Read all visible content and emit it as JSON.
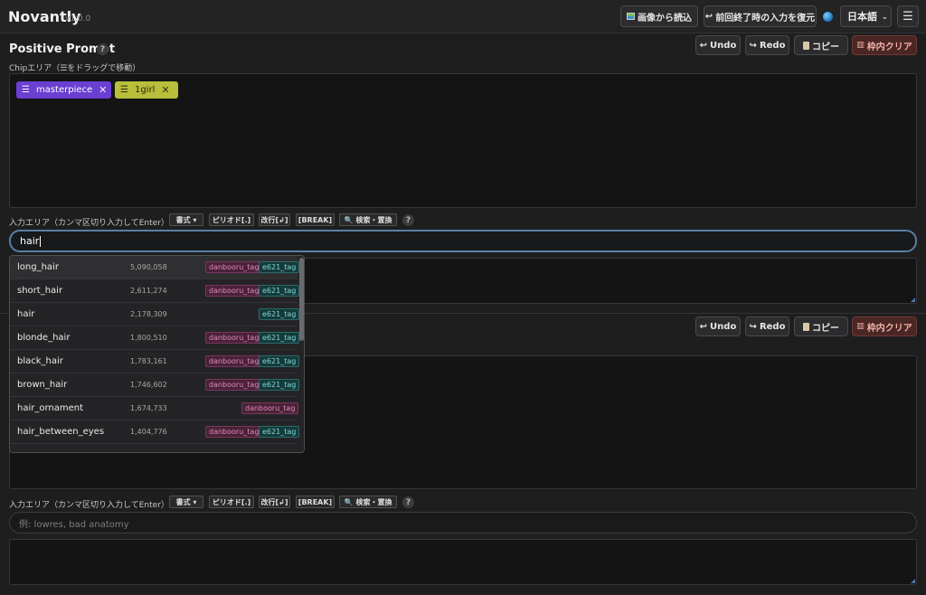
{
  "app": {
    "title": "Novantly",
    "version": "v1.0.0"
  },
  "topbar": {
    "load_from_image": "画像から読込",
    "restore_last_input": "前回終了時の入力を復元",
    "language": "日本語",
    "menu_icon": "☰"
  },
  "positive": {
    "title": "Positive Prompt",
    "help": "?",
    "chip_area_label": "Chipエリア（☰をドラッグで移動）",
    "undo": "Undo",
    "redo": "Redo",
    "copy": "コピー",
    "clear": "枠内クリア",
    "chips": [
      {
        "label": "masterpiece",
        "color": "#6a3fd1"
      },
      {
        "label": "1girl",
        "color": "#b8bf3a"
      }
    ],
    "input_area_label": "入力エリア（カンマ区切り入力してEnter）",
    "tools": {
      "format": "書式 ▾",
      "period": "ピリオド[.]",
      "newline": "改行[↲]",
      "break": "[BREAK]",
      "search_replace": "検索・置換"
    },
    "input_value": "hair"
  },
  "autocomplete": [
    {
      "name": "long_hair",
      "count": "5,090,058",
      "danbooru": "danbooru_tag",
      "e621": "e621_tag"
    },
    {
      "name": "short_hair",
      "count": "2,611,274",
      "danbooru": "danbooru_tag",
      "e621": "e621_tag"
    },
    {
      "name": "hair",
      "count": "2,178,309",
      "danbooru": "",
      "e621": "e621_tag"
    },
    {
      "name": "blonde_hair",
      "count": "1,800,510",
      "danbooru": "danbooru_tag",
      "e621": "e621_tag"
    },
    {
      "name": "black_hair",
      "count": "1,783,161",
      "danbooru": "danbooru_tag",
      "e621": "e621_tag"
    },
    {
      "name": "brown_hair",
      "count": "1,746,602",
      "danbooru": "danbooru_tag",
      "e621": "e621_tag"
    },
    {
      "name": "hair_ornament",
      "count": "1,674,733",
      "danbooru": "danbooru_tag",
      "e621": ""
    },
    {
      "name": "hair_between_eyes",
      "count": "1,404,776",
      "danbooru": "danbooru_tag",
      "e621": "e621_tag"
    }
  ],
  "negative": {
    "undo": "Undo",
    "redo": "Redo",
    "copy": "コピー",
    "clear": "枠内クリア",
    "input_area_label": "入力エリア（カンマ区切り入力してEnter）",
    "tools": {
      "format": "書式 ▾",
      "period": "ピリオド[.]",
      "newline": "改行[↲]",
      "break": "[BREAK]",
      "search_replace": "検索・置換"
    },
    "help": "?",
    "input_placeholder": "例: lowres, bad anatomy"
  }
}
